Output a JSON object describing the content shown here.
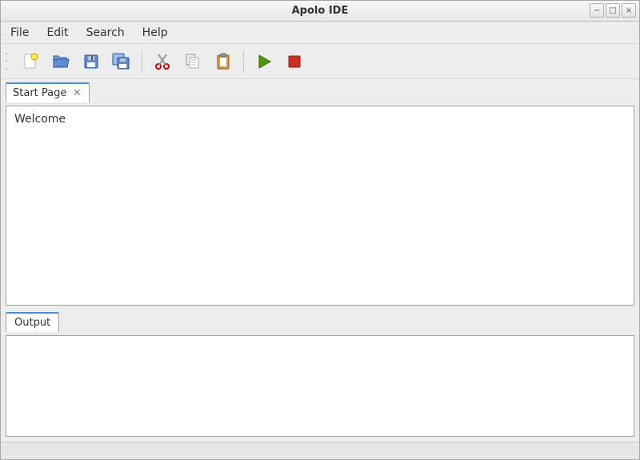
{
  "title": "Apolo IDE",
  "menubar": {
    "file": "File",
    "edit": "Edit",
    "search": "Search",
    "help": "Help"
  },
  "toolbar": {
    "new": "new-file",
    "open": "open-file",
    "save": "save",
    "saveall": "save-all",
    "cut": "cut",
    "copy": "copy",
    "paste": "paste",
    "run": "run",
    "stop": "stop"
  },
  "tabs": {
    "startpage": "Start Page"
  },
  "editor": {
    "welcome": "Welcome"
  },
  "bottom_tabs": {
    "output": "Output"
  },
  "window_controls": {
    "min": "−",
    "max": "□",
    "close": "×"
  }
}
